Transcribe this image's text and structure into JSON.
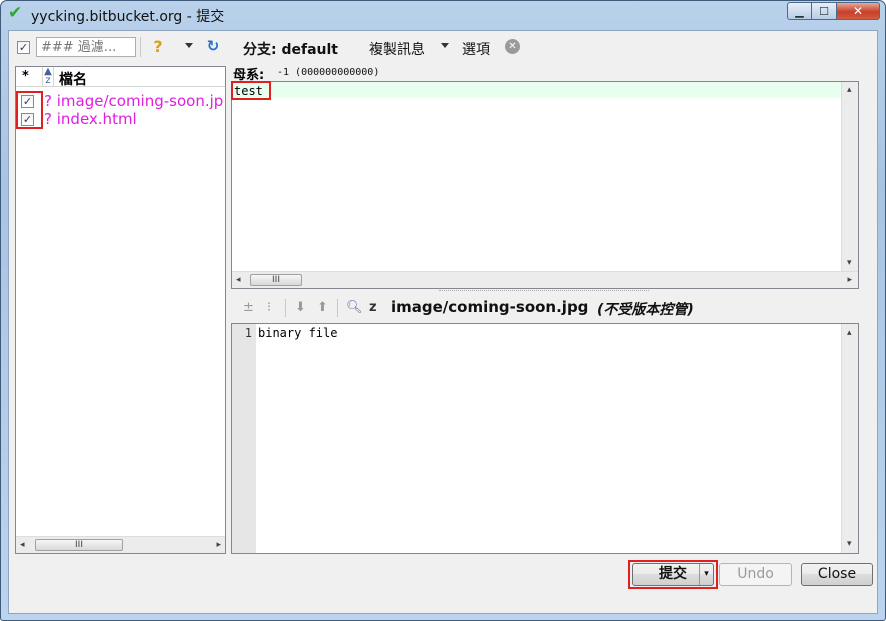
{
  "window": {
    "title": "yycking.bitbucket.org - 提交",
    "title_icon": "check-icon",
    "controls": {
      "minimize": "_",
      "maximize": "□",
      "close": "x"
    }
  },
  "toolbar": {
    "filter_placeholder": "### 過濾...",
    "branch_label": "分支: default",
    "copy_message_label": "複製訊息",
    "options_label": "選項",
    "icons": [
      "select-all-checkbox",
      "help-icon",
      "refresh-icon",
      "close-circle-icon"
    ]
  },
  "file_list": {
    "col_status": "*",
    "col_sort": "Ζ",
    "col_name": "檔名",
    "files": [
      {
        "status": "?",
        "name": "image/coming-soon.jpg",
        "checked": true
      },
      {
        "status": "?",
        "name": "index.html",
        "checked": true
      }
    ]
  },
  "commit": {
    "parent_label": "母系:",
    "parent_value": "-1 (000000000000)",
    "message": "test"
  },
  "diff": {
    "file": "image/coming-soon.jpg",
    "note": "(不受版本控管)",
    "lines": [
      {
        "no": "1",
        "text": "binary file"
      }
    ]
  },
  "buttons": {
    "commit": "提交",
    "undo": "Undo",
    "close": "Close"
  },
  "colors": {
    "untracked_file": "#e01ee0",
    "highlight_box": "#e02020",
    "message_line_bg": "#e8fff0"
  }
}
